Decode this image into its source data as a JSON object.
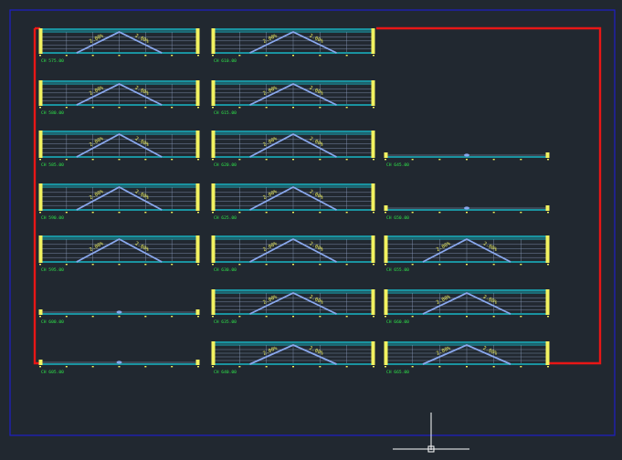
{
  "colors": {
    "background": "#212830",
    "outer_frame": "#1e1ec8",
    "boundary": "#e81616",
    "header_band": "#1a93a0",
    "grid": "#8fa0c2",
    "profile": "#8aa8ee",
    "annotation": "#f2f260",
    "caption": "#2ee84a",
    "cursor": "#ffffff"
  },
  "sections": [
    {
      "col": 0,
      "row": 0,
      "caption": "CH 575.00",
      "profile": "peak",
      "left_slope": "2.00%",
      "right_slope": "2.00%"
    },
    {
      "col": 0,
      "row": 1,
      "caption": "CH 580.00",
      "profile": "peak",
      "left_slope": "2.00%",
      "right_slope": "2.00%"
    },
    {
      "col": 0,
      "row": 2,
      "caption": "CH 585.00",
      "profile": "peak",
      "left_slope": "2.00%",
      "right_slope": "2.00%"
    },
    {
      "col": 0,
      "row": 3,
      "caption": "CH 590.00",
      "profile": "peak",
      "left_slope": "2.00%",
      "right_slope": "2.00%"
    },
    {
      "col": 0,
      "row": 4,
      "caption": "CH 595.00",
      "profile": "peak",
      "left_slope": "2.00%",
      "right_slope": "2.00%"
    },
    {
      "col": 0,
      "row": 5,
      "caption": "CH 600.00",
      "profile": "flat"
    },
    {
      "col": 0,
      "row": 6,
      "caption": "CH 605.00",
      "profile": "flat"
    },
    {
      "col": 1,
      "row": 0,
      "caption": "CH 610.00",
      "profile": "peak",
      "left_slope": "2.00%",
      "right_slope": "2.00%"
    },
    {
      "col": 1,
      "row": 1,
      "caption": "CH 615.00",
      "profile": "peak",
      "left_slope": "2.00%",
      "right_slope": "2.00%"
    },
    {
      "col": 1,
      "row": 2,
      "caption": "CH 620.00",
      "profile": "peak",
      "left_slope": "2.00%",
      "right_slope": "2.00%"
    },
    {
      "col": 1,
      "row": 3,
      "caption": "CH 625.00",
      "profile": "peak",
      "left_slope": "2.00%",
      "right_slope": "2.00%"
    },
    {
      "col": 1,
      "row": 4,
      "caption": "CH 630.00",
      "profile": "peak",
      "left_slope": "2.00%",
      "right_slope": "2.00%"
    },
    {
      "col": 1,
      "row": 5,
      "caption": "CH 635.00",
      "profile": "peak",
      "left_slope": "2.00%",
      "right_slope": "2.00%"
    },
    {
      "col": 1,
      "row": 6,
      "caption": "CH 640.00",
      "profile": "peak",
      "left_slope": "2.00%",
      "right_slope": "2.00%"
    },
    {
      "col": 2,
      "row": 2,
      "caption": "CH 645.00",
      "profile": "flat"
    },
    {
      "col": 2,
      "row": 3,
      "caption": "CH 650.00",
      "profile": "flat"
    },
    {
      "col": 2,
      "row": 4,
      "caption": "CH 655.00",
      "profile": "peak",
      "left_slope": "2.00%",
      "right_slope": "2.00%"
    },
    {
      "col": 2,
      "row": 5,
      "caption": "CH 660.00",
      "profile": "peak",
      "left_slope": "2.00%",
      "right_slope": "2.00%"
    },
    {
      "col": 2,
      "row": 6,
      "caption": "CH 665.00",
      "profile": "peak",
      "left_slope": "2.00%",
      "right_slope": "2.00%"
    }
  ]
}
